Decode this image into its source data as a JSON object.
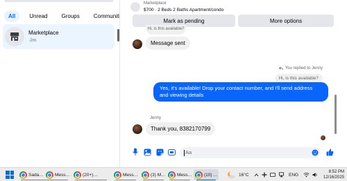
{
  "left_pane": {
    "filters": [
      {
        "label": "All",
        "active": true
      },
      {
        "label": "Unread",
        "active": false
      },
      {
        "label": "Groups",
        "active": false
      },
      {
        "label": "Communities",
        "active": false
      }
    ],
    "conversation": {
      "title": "Marketplace",
      "subtitle": "·2m",
      "icon": "storefront-icon"
    }
  },
  "chat": {
    "header": {
      "label": "Marketplace",
      "title": "$700 · 2 Beds 2 Baths Apartment/condo",
      "mark_pending_label": "Mark as pending",
      "more_options_label": "More options"
    },
    "cut_bubble_text": "Hi, is this available?",
    "messages": {
      "message_sent": "Message sent",
      "reply_note": "You replied to Jenny",
      "quoted": "Hi, is this available?",
      "outgoing": "Yes, it's available! Drop your contact number, and I'll send address and viewing details",
      "sender": "Jenny",
      "incoming": "Thank you, 8382170799"
    },
    "composer": {
      "placeholder": "Aa"
    },
    "accent_color": "#0866ff"
  },
  "taskbar": {
    "apps": [
      {
        "label": "Sada…",
        "active": false
      },
      {
        "label": "Mess…",
        "active": false
      },
      {
        "label": "(20+)…",
        "active": false
      },
      {
        "label": "Mess…",
        "active": false
      },
      {
        "label": "(3) M…",
        "active": false
      },
      {
        "label": "Mess…",
        "active": false
      },
      {
        "label": "(10) …",
        "active": true
      }
    ],
    "weather": "16°C",
    "language": "ENG",
    "time": "8:52 PM",
    "date": "12/16/2025"
  }
}
